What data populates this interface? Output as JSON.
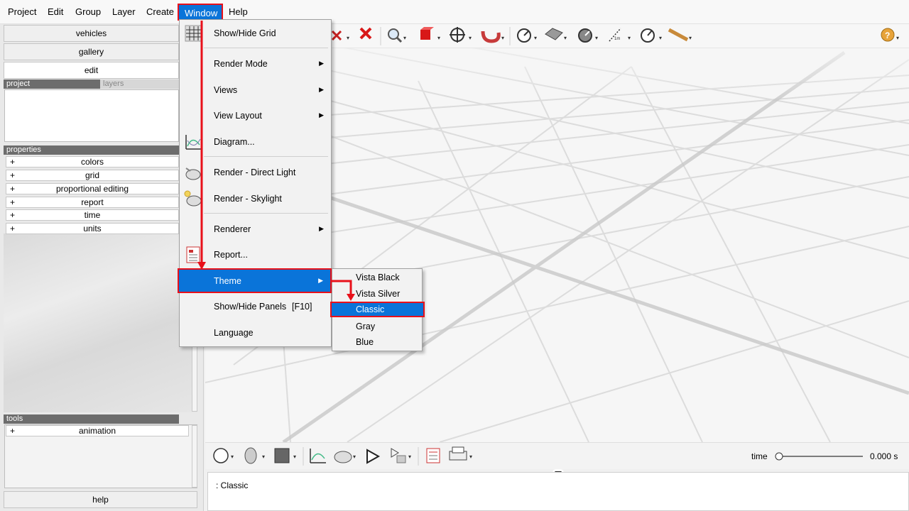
{
  "menubar": {
    "items": [
      "Project",
      "Edit",
      "Group",
      "Layer",
      "Create",
      "Window",
      "Help"
    ]
  },
  "left_panel": {
    "buttons": [
      "vehicles",
      "gallery",
      "edit"
    ],
    "tabs": {
      "project": "project",
      "layers": "layers"
    },
    "properties_header": "properties",
    "properties": [
      "colors",
      "grid",
      "proportional editing",
      "report",
      "time",
      "units"
    ],
    "plus": "+",
    "tools_header": "tools",
    "tools": [
      "animation"
    ],
    "help_button": "help"
  },
  "window_menu": {
    "items": [
      {
        "label": "Show/Hide Grid",
        "icon": "grid-icon"
      },
      {
        "label": "Render Mode",
        "submenu": true
      },
      {
        "label": "Views",
        "submenu": true
      },
      {
        "label": "View Layout",
        "submenu": true
      },
      {
        "label": "Diagram...",
        "icon": "diagram-icon"
      },
      {
        "label": "Render - Direct Light",
        "icon": "teapot-light-icon"
      },
      {
        "label": "Render - Skylight",
        "icon": "teapot-sky-icon"
      },
      {
        "label": "Renderer",
        "submenu": true
      },
      {
        "label": "Report...",
        "icon": "report-icon"
      },
      {
        "label": "Theme",
        "submenu": true,
        "highlighted": true
      },
      {
        "label": "Show/Hide Panels",
        "shortcut": "[F10]"
      },
      {
        "label": "Language"
      }
    ]
  },
  "theme_submenu": {
    "items": [
      "Vista Black",
      "Vista Silver",
      "Classic",
      "Gray",
      "Blue"
    ],
    "selected": "Classic"
  },
  "bottom_toolbar": {
    "time_label": "time",
    "time_value": "0.000 s",
    "time_slider_fraction": 0
  },
  "status": {
    "text": ": Classic"
  },
  "colors": {
    "highlight": "#0a74d9",
    "annotation_red": "#e8101a"
  }
}
